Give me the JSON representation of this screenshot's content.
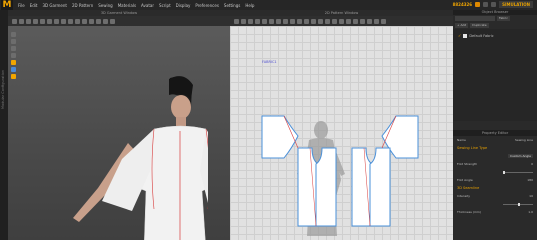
{
  "app": {
    "logo": "M",
    "menus": [
      "File",
      "Edit",
      "3D Garment",
      "2D Pattern",
      "Sewing",
      "Materials",
      "Avatar",
      "Script",
      "Display",
      "Preferences",
      "Settings",
      "Help"
    ],
    "status_number": "8824326",
    "simulation_label": "SIMULATION"
  },
  "left_strip": {
    "label": "Modular Configuration"
  },
  "window_3d": {
    "title": "3D Garment Window"
  },
  "window_2d": {
    "title": "2D Pattern Window",
    "fabric_label": "FABRIC1"
  },
  "object_browser": {
    "title": "Object Browser",
    "buttons": [
      "Fabric",
      "+ Add",
      "Duplicate"
    ],
    "fabric_item": "Default Fabric"
  },
  "property_editor": {
    "title": "Property Editor",
    "header_left": "Name",
    "header_right": "Sewing Line",
    "section_sewing": "Sewing Line Type",
    "sewing_type_value": "Custom Angle",
    "fold_strength_label": "Fold Strength",
    "fold_strength_value": "0",
    "fold_angle_label": "Fold Angle",
    "fold_angle_value": "180",
    "section_3d": "3D Seamline",
    "intensity_label": "Intensity",
    "intensity_value": "10",
    "thickness_label": "Thickness (mm)",
    "thickness_value": "1.0",
    "fold_strength_level": 0.0,
    "intensity_level": 0.5
  },
  "colors": {
    "accent": "#e6a000",
    "pattern_outline": "#4a90d9",
    "sewing_line": "#d83a3a",
    "background_2d": "#e1e1e1"
  }
}
